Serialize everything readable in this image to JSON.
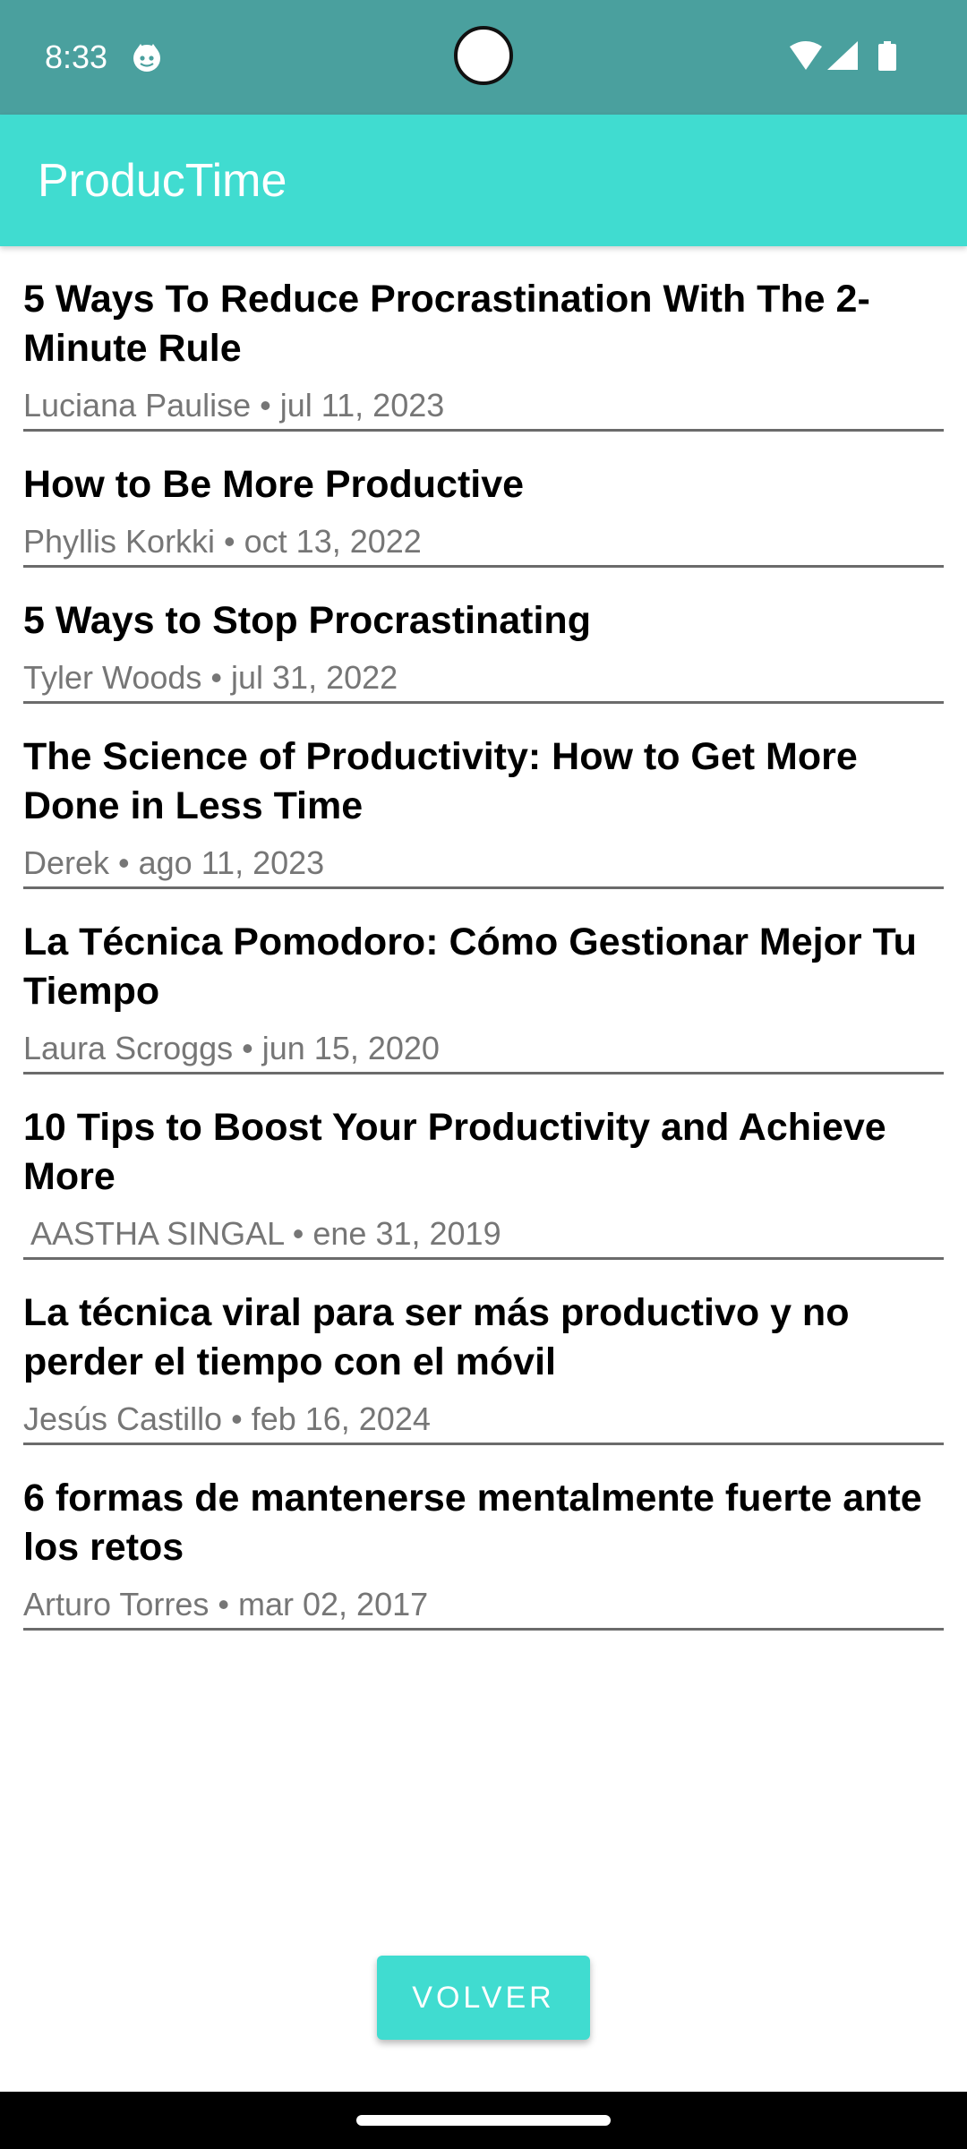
{
  "status_bar": {
    "time": "8:33",
    "icons": [
      "app-notification-icon",
      "wifi-icon",
      "cellular-signal-icon",
      "battery-icon"
    ]
  },
  "app_bar": {
    "title": "ProducTime",
    "color": "#40dcd0"
  },
  "articles": [
    {
      "title": "5 Ways To Reduce Procrastination With The 2-Minute Rule",
      "meta": "Luciana Paulise • jul 11, 2023"
    },
    {
      "title": "How to Be More Productive",
      "meta": "Phyllis Korkki • oct 13, 2022"
    },
    {
      "title": "5 Ways to Stop Procrastinating",
      "meta": "Tyler Woods • jul 31, 2022"
    },
    {
      "title": "The Science of Productivity: How to Get More Done in Less Time",
      "meta": "Derek • ago 11, 2023"
    },
    {
      "title": "La Técnica Pomodoro: Cómo Gestionar Mejor Tu Tiempo",
      "meta": "Laura Scroggs • jun 15, 2020"
    },
    {
      "title": "10 Tips to Boost Your Productivity and Achieve More",
      "meta": " AASTHA SINGAL • ene 31, 2019"
    },
    {
      "title": "La técnica viral para ser más productivo y no perder el tiempo con el móvil",
      "meta": "Jesús Castillo • feb 16, 2024"
    },
    {
      "title": "6 formas de mantenerse mentalmente fuerte ante los retos",
      "meta": "Arturo Torres • mar 02, 2017"
    }
  ],
  "back_button": {
    "label": "VOLVER"
  }
}
